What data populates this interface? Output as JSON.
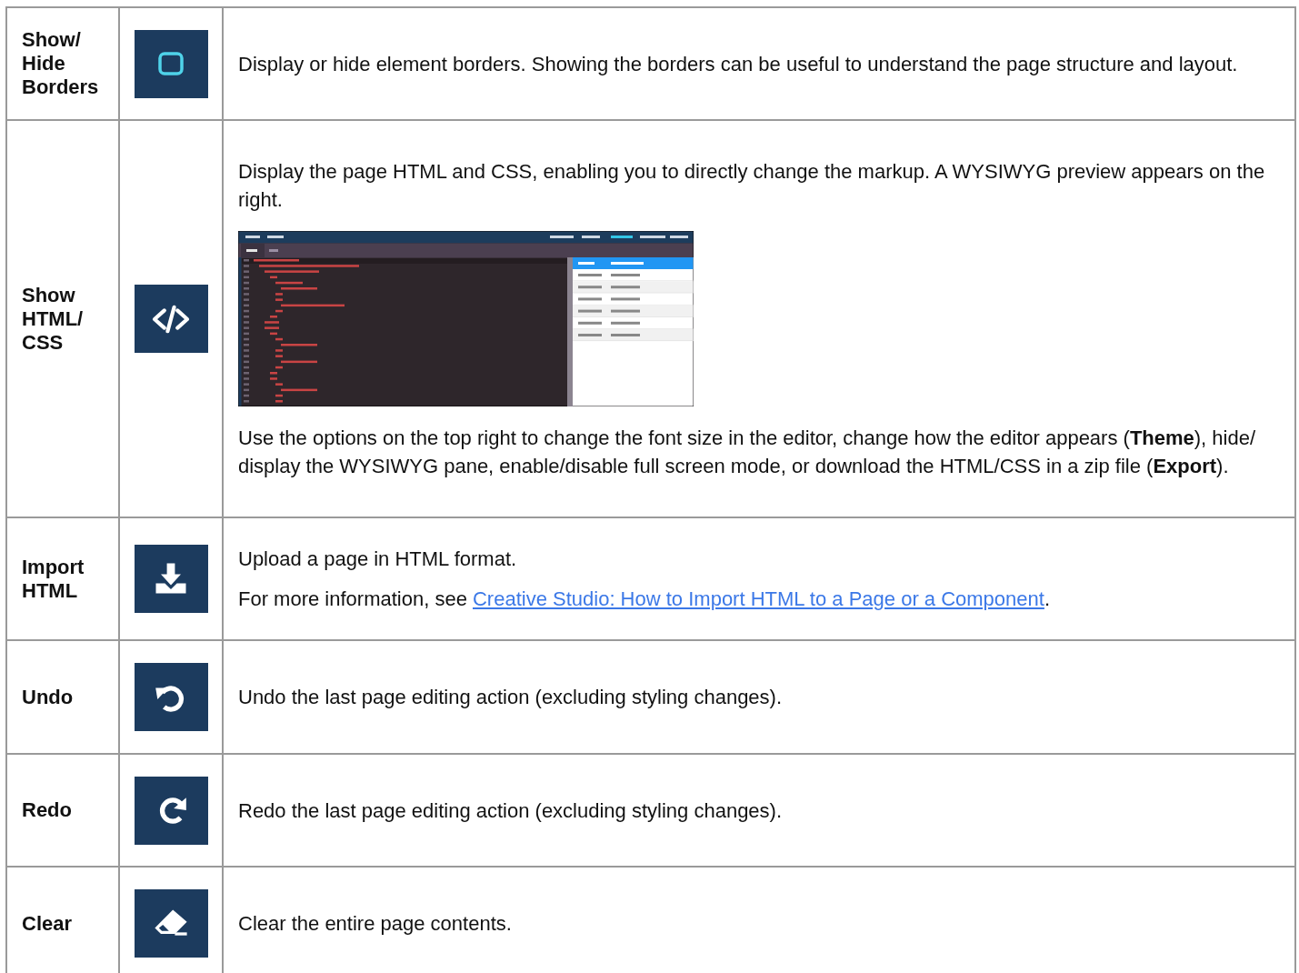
{
  "rows": [
    {
      "label": "Show/ Hide Borders",
      "paragraphs": [
        {
          "text": "Display or hide element borders. Showing the borders can be useful to understand the page structure and layout."
        }
      ]
    },
    {
      "label": "Show HTML/ CSS",
      "paragraphs": [
        {
          "text": "Display the page HTML and CSS, enabling you to directly change the markup. A WYSIWYG preview appears on the right."
        }
      ],
      "after": [
        {
          "text": "Use the options on the top right to change the font size in the editor, change how the editor appears (**Theme**), hide/ display the WYSIWYG pane, enable/disable full screen mode, or download the HTML/CSS in a zip file (**Export**)."
        }
      ]
    },
    {
      "label": "Import HTML",
      "paragraphs": [
        {
          "text": "Upload a page in HTML format."
        },
        {
          "text": "For more information, see ",
          "link": "Creative Studio: How to Import HTML to a Page or a Component",
          "after": "."
        }
      ]
    },
    {
      "label": "Undo",
      "paragraphs": [
        {
          "text": "Undo the last page editing action (excluding styling changes)."
        }
      ]
    },
    {
      "label": "Redo",
      "paragraphs": [
        {
          "text": "Redo the last page editing action (excluding styling changes)."
        }
      ]
    },
    {
      "label": "Clear",
      "paragraphs": [
        {
          "text": "Clear the entire page contents."
        }
      ]
    }
  ]
}
